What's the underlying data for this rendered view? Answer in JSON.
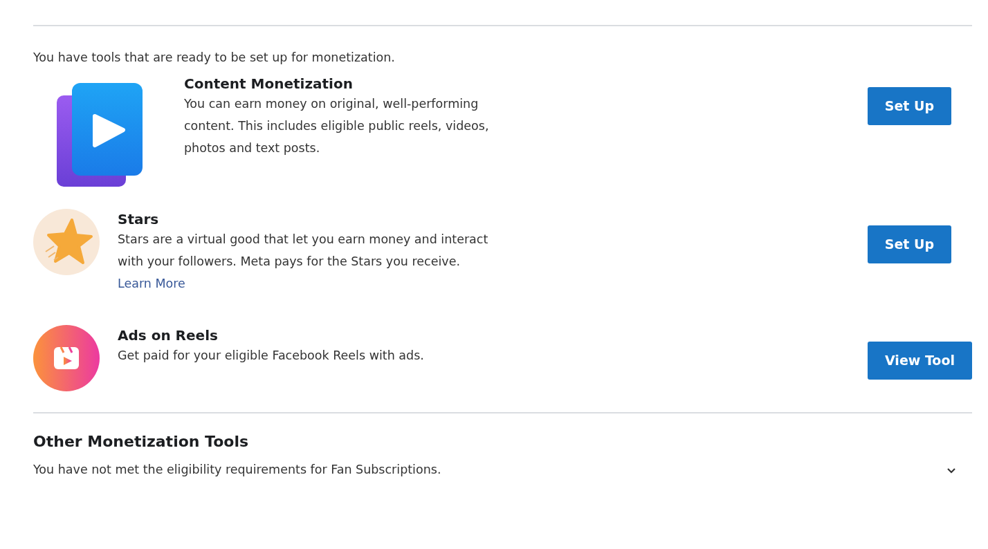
{
  "intro": "You have tools that are ready to be set up for monetization.",
  "tools": [
    {
      "kind": "content",
      "title": "Content Monetization",
      "description": "You can earn money on original, well-performing content. This includes eligible public reels, videos, photos and text posts.",
      "button": "Set Up"
    },
    {
      "kind": "stars",
      "title": "Stars",
      "description": "Stars are a virtual good that let you earn money and interact with your followers. Meta pays for the Stars you receive.",
      "link": "Learn More",
      "button": "Set Up"
    },
    {
      "kind": "reels",
      "title": "Ads on Reels",
      "description": "Get paid for your eligible Facebook Reels with ads.",
      "button": "View Tool"
    }
  ],
  "other": {
    "title": "Other Monetization Tools",
    "description": "You have not met the eligibility requirements for Fan Subscriptions.",
    "expanded": false
  }
}
